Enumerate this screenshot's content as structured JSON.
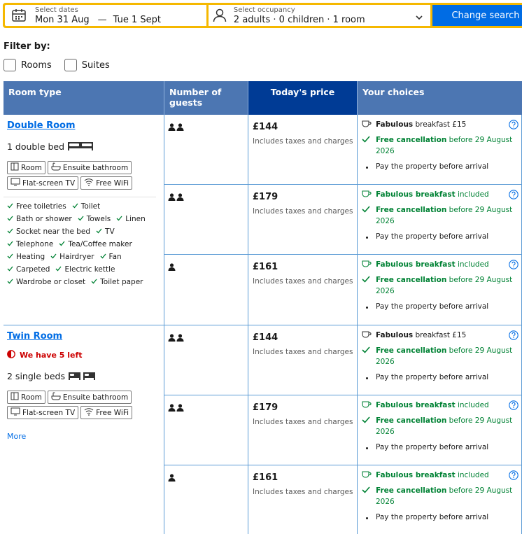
{
  "search": {
    "dates_label": "Select dates",
    "check_in": "Mon 31 Aug",
    "dash": "—",
    "check_out": "Tue 1 Sept",
    "occupancy_label": "Select occupancy",
    "occupancy_value": "2 adults · 0 children · 1 room",
    "change_button": "Change search"
  },
  "filter": {
    "title": "Filter by:",
    "options": [
      "Rooms",
      "Suites"
    ]
  },
  "table_headers": [
    "Room type",
    "Number of guests",
    "Today's price",
    "Your choices"
  ],
  "rooms": [
    {
      "name": "Double Room",
      "beds": "1 double bed",
      "facilities": [
        "Room",
        "Ensuite bathroom",
        "Flat-screen TV",
        "Free WiFi"
      ],
      "amenities": [
        "Free toiletries",
        "Toilet",
        "Bath or shower",
        "Towels",
        "Linen",
        "Socket near the bed",
        "TV",
        "Telephone",
        "Tea/Coffee maker",
        "Heating",
        "Hairdryer",
        "Fan",
        "Carpeted",
        "Electric kettle",
        "Wardrobe or closet",
        "Toilet paper"
      ],
      "options": [
        {
          "guests": 2,
          "price": "£144",
          "taxes": "Includes taxes and charges",
          "breakfast_bold": "Fabulous",
          "breakfast_rest": "breakfast £15",
          "breakfast_included": false,
          "cancel_bold": "Free cancellation",
          "cancel_rest": "before 29 August 2026",
          "pay": "Pay the property before arrival"
        },
        {
          "guests": 2,
          "price": "£179",
          "taxes": "Includes taxes and charges",
          "breakfast_bold": "Fabulous breakfast",
          "breakfast_rest": "included",
          "breakfast_included": true,
          "cancel_bold": "Free cancellation",
          "cancel_rest": "before 29 August 2026",
          "pay": "Pay the property before arrival"
        },
        {
          "guests": 1,
          "price": "£161",
          "taxes": "Includes taxes and charges",
          "breakfast_bold": "Fabulous breakfast",
          "breakfast_rest": "included",
          "breakfast_included": true,
          "cancel_bold": "Free cancellation",
          "cancel_rest": "before 29 August 2026",
          "pay": "Pay the property before arrival"
        }
      ]
    },
    {
      "name": "Twin Room",
      "scarcity": "We have 5 left",
      "beds": "2 single beds",
      "facilities": [
        "Room",
        "Ensuite bathroom",
        "Flat-screen TV",
        "Free WiFi"
      ],
      "more": "More",
      "options": [
        {
          "guests": 2,
          "price": "£144",
          "taxes": "Includes taxes and charges",
          "breakfast_bold": "Fabulous",
          "breakfast_rest": "breakfast £15",
          "breakfast_included": false,
          "cancel_bold": "Free cancellation",
          "cancel_rest": "before 29 August 2026",
          "pay": "Pay the property before arrival"
        },
        {
          "guests": 2,
          "price": "£179",
          "taxes": "Includes taxes and charges",
          "breakfast_bold": "Fabulous breakfast",
          "breakfast_rest": "included",
          "breakfast_included": true,
          "cancel_bold": "Free cancellation",
          "cancel_rest": "before 29 August 2026",
          "pay": "Pay the property before arrival"
        },
        {
          "guests": 1,
          "price": "£161",
          "taxes": "Includes taxes and charges",
          "breakfast_bold": "Fabulous breakfast",
          "breakfast_rest": "included",
          "breakfast_included": true,
          "cancel_bold": "Free cancellation",
          "cancel_rest": "before 29 August 2026",
          "pay": "Pay the property before arrival"
        }
      ]
    }
  ],
  "colors": {
    "accent": "#006ce4",
    "header": "#4c76b2",
    "header_dark": "#003b95",
    "green": "#008234",
    "search_border": "#f5b800",
    "alert": "#cc0000"
  }
}
